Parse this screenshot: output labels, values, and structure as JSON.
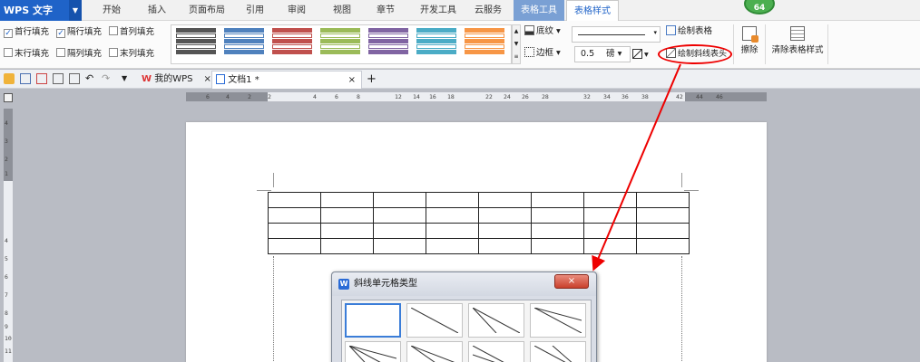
{
  "app": {
    "name": "WPS 文字",
    "badge": "64"
  },
  "menu": [
    "开始",
    "插入",
    "页面布局",
    "引用",
    "审阅",
    "视图",
    "章节",
    "开发工具",
    "云服务"
  ],
  "context_tabs": {
    "tool": "表格工具",
    "style": "表格样式"
  },
  "ribbon": {
    "checks": [
      {
        "label": "首行填充",
        "checked": true
      },
      {
        "label": "隔行填充",
        "checked": true
      },
      {
        "label": "首列填充",
        "checked": false
      },
      {
        "label": "末行填充",
        "checked": false
      },
      {
        "label": "隔列填充",
        "checked": false
      },
      {
        "label": "末列填充",
        "checked": false
      }
    ],
    "shading": "底纹",
    "border": "边框",
    "draw_table": "绘制表格",
    "draw_diagonal": "绘制斜线表头",
    "line_weight": "0.5",
    "line_weight_unit": "磅",
    "erase": "擦除",
    "clear_style": "清除表格样式",
    "swatch_colors": [
      "#555555",
      "#4f81bd",
      "#c0504d",
      "#9bbb59",
      "#8064a2",
      "#4bacc6",
      "#f79646"
    ]
  },
  "tabs": {
    "my_wps": "我的WPS",
    "doc": "文档1 *"
  },
  "ruler": {
    "h_ticks": [
      "6",
      "4",
      "2",
      "2",
      "4",
      "6",
      "8",
      "12",
      "14",
      "16",
      "18",
      "22",
      "24",
      "26",
      "28",
      "32",
      "34",
      "36",
      "38",
      "42",
      "44",
      "46"
    ],
    "v_ticks": [
      "4",
      "3",
      "2",
      "1",
      "4",
      "5",
      "6",
      "7",
      "8",
      "9",
      "10",
      "11"
    ]
  },
  "dialog": {
    "title": "斜线单元格类型",
    "close": "×"
  },
  "colors": {
    "wps_blue": "#1f63c8",
    "annotation_red": "#e00000"
  }
}
